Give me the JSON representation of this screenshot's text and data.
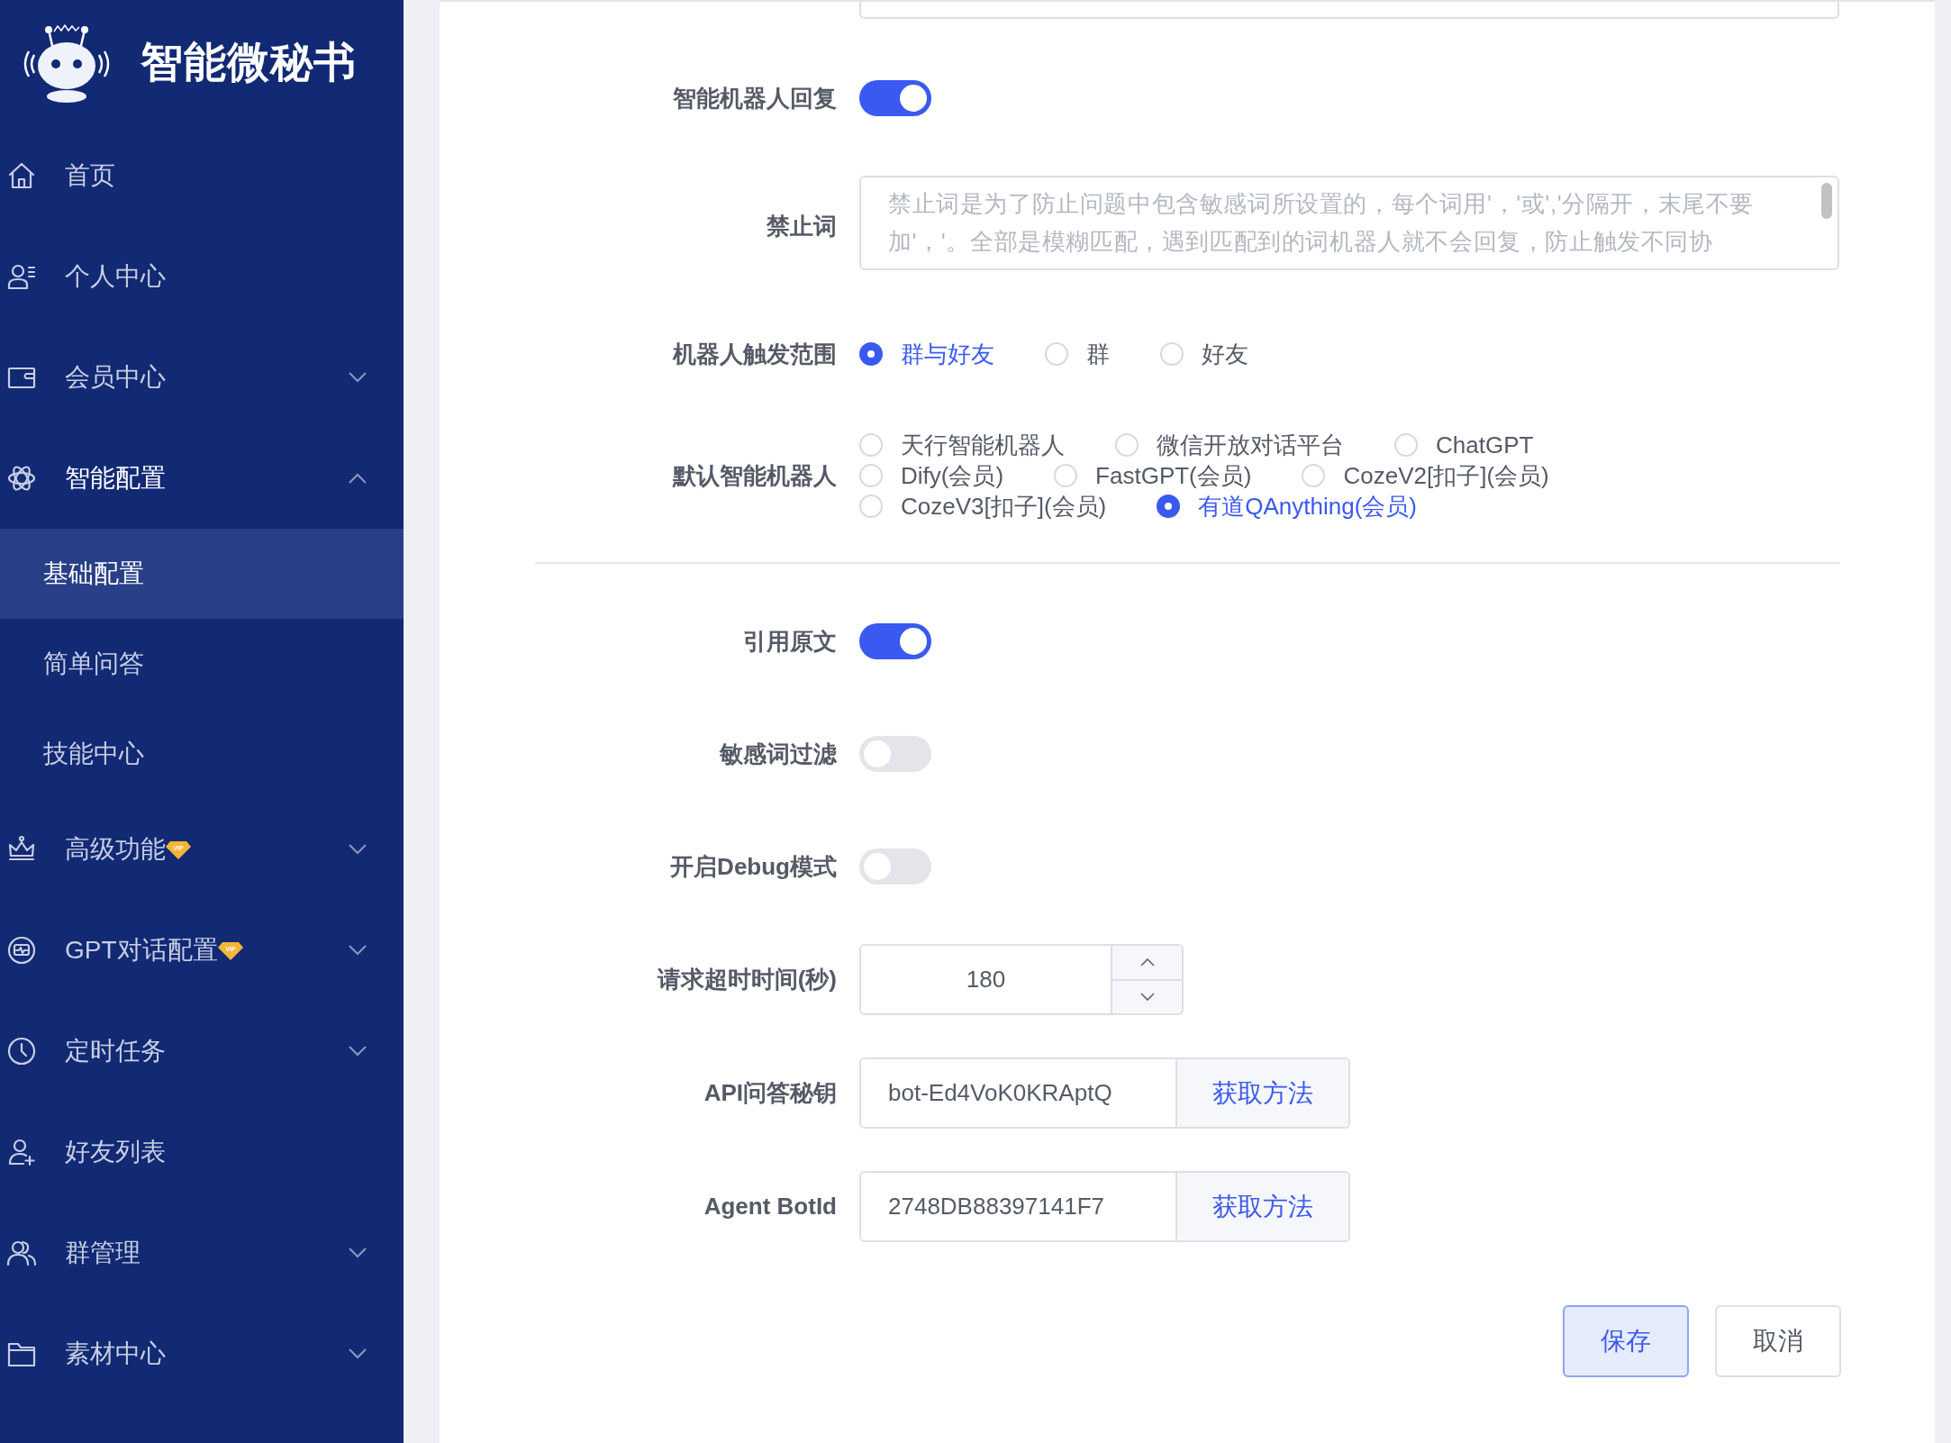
{
  "brand": {
    "title": "智能微秘书"
  },
  "sidebar": {
    "items": [
      {
        "label": "首页"
      },
      {
        "label": "个人中心"
      },
      {
        "label": "会员中心",
        "expanded": false
      },
      {
        "label": "智能配置",
        "expanded": true,
        "children": [
          {
            "label": "基础配置",
            "selected": true
          },
          {
            "label": "简单问答",
            "selected": false
          },
          {
            "label": "技能中心",
            "selected": false
          }
        ]
      },
      {
        "label": "高级功能",
        "badge": "VIP",
        "expanded": false
      },
      {
        "label": "GPT对话配置",
        "badge": "VIP",
        "expanded": false
      },
      {
        "label": "定时任务",
        "expanded": false
      },
      {
        "label": "好友列表"
      },
      {
        "label": "群管理",
        "expanded": false
      },
      {
        "label": "素材中心",
        "expanded": false
      }
    ]
  },
  "form": {
    "fields": [
      {
        "kind": "switch",
        "label": "智能机器人回复",
        "on": true
      },
      {
        "kind": "textarea",
        "label": "禁止词",
        "placeholder": "禁止词是为了防止问题中包含敏感词所设置的，每个词用'，'或','分隔开，末尾不要加'，'。全部是模糊匹配，遇到匹配到的词机器人就不会回复，防止触发不同协"
      },
      {
        "kind": "radio",
        "label": "机器人触发范围",
        "options": [
          {
            "label": "群与好友",
            "selected": true
          },
          {
            "label": "群",
            "selected": false
          },
          {
            "label": "好友",
            "selected": false
          }
        ]
      },
      {
        "kind": "radio",
        "label": "默认智能机器人",
        "options": [
          {
            "label": "天行智能机器人",
            "selected": false
          },
          {
            "label": "微信开放对话平台",
            "selected": false
          },
          {
            "label": "ChatGPT",
            "selected": false
          },
          {
            "label": "Dify(会员)",
            "selected": false
          },
          {
            "label": "FastGPT(会员)",
            "selected": false
          },
          {
            "label": "CozeV2[扣子](会员)",
            "selected": false
          },
          {
            "label": "CozeV3[扣子](会员)",
            "selected": false
          },
          {
            "label": "有道QAnything(会员)",
            "selected": true
          }
        ]
      },
      {
        "kind": "divider"
      },
      {
        "kind": "switch",
        "label": "引用原文",
        "on": true
      },
      {
        "kind": "switch",
        "label": "敏感词过滤",
        "on": false
      },
      {
        "kind": "switch",
        "label": "开启Debug模式",
        "on": false
      },
      {
        "kind": "number",
        "label": "请求超时时间(秒)",
        "value": "180"
      },
      {
        "kind": "addon",
        "label": "API问答秘钥",
        "value": "bot-Ed4VoK0KRAptQ",
        "button": "获取方法"
      },
      {
        "kind": "addon",
        "label": "Agent BotId",
        "value": "2748DB88397141F7",
        "button": "获取方法"
      }
    ],
    "buttons": [
      {
        "kind": "primary",
        "label": "保存"
      },
      {
        "kind": "default",
        "label": "取消"
      }
    ]
  }
}
